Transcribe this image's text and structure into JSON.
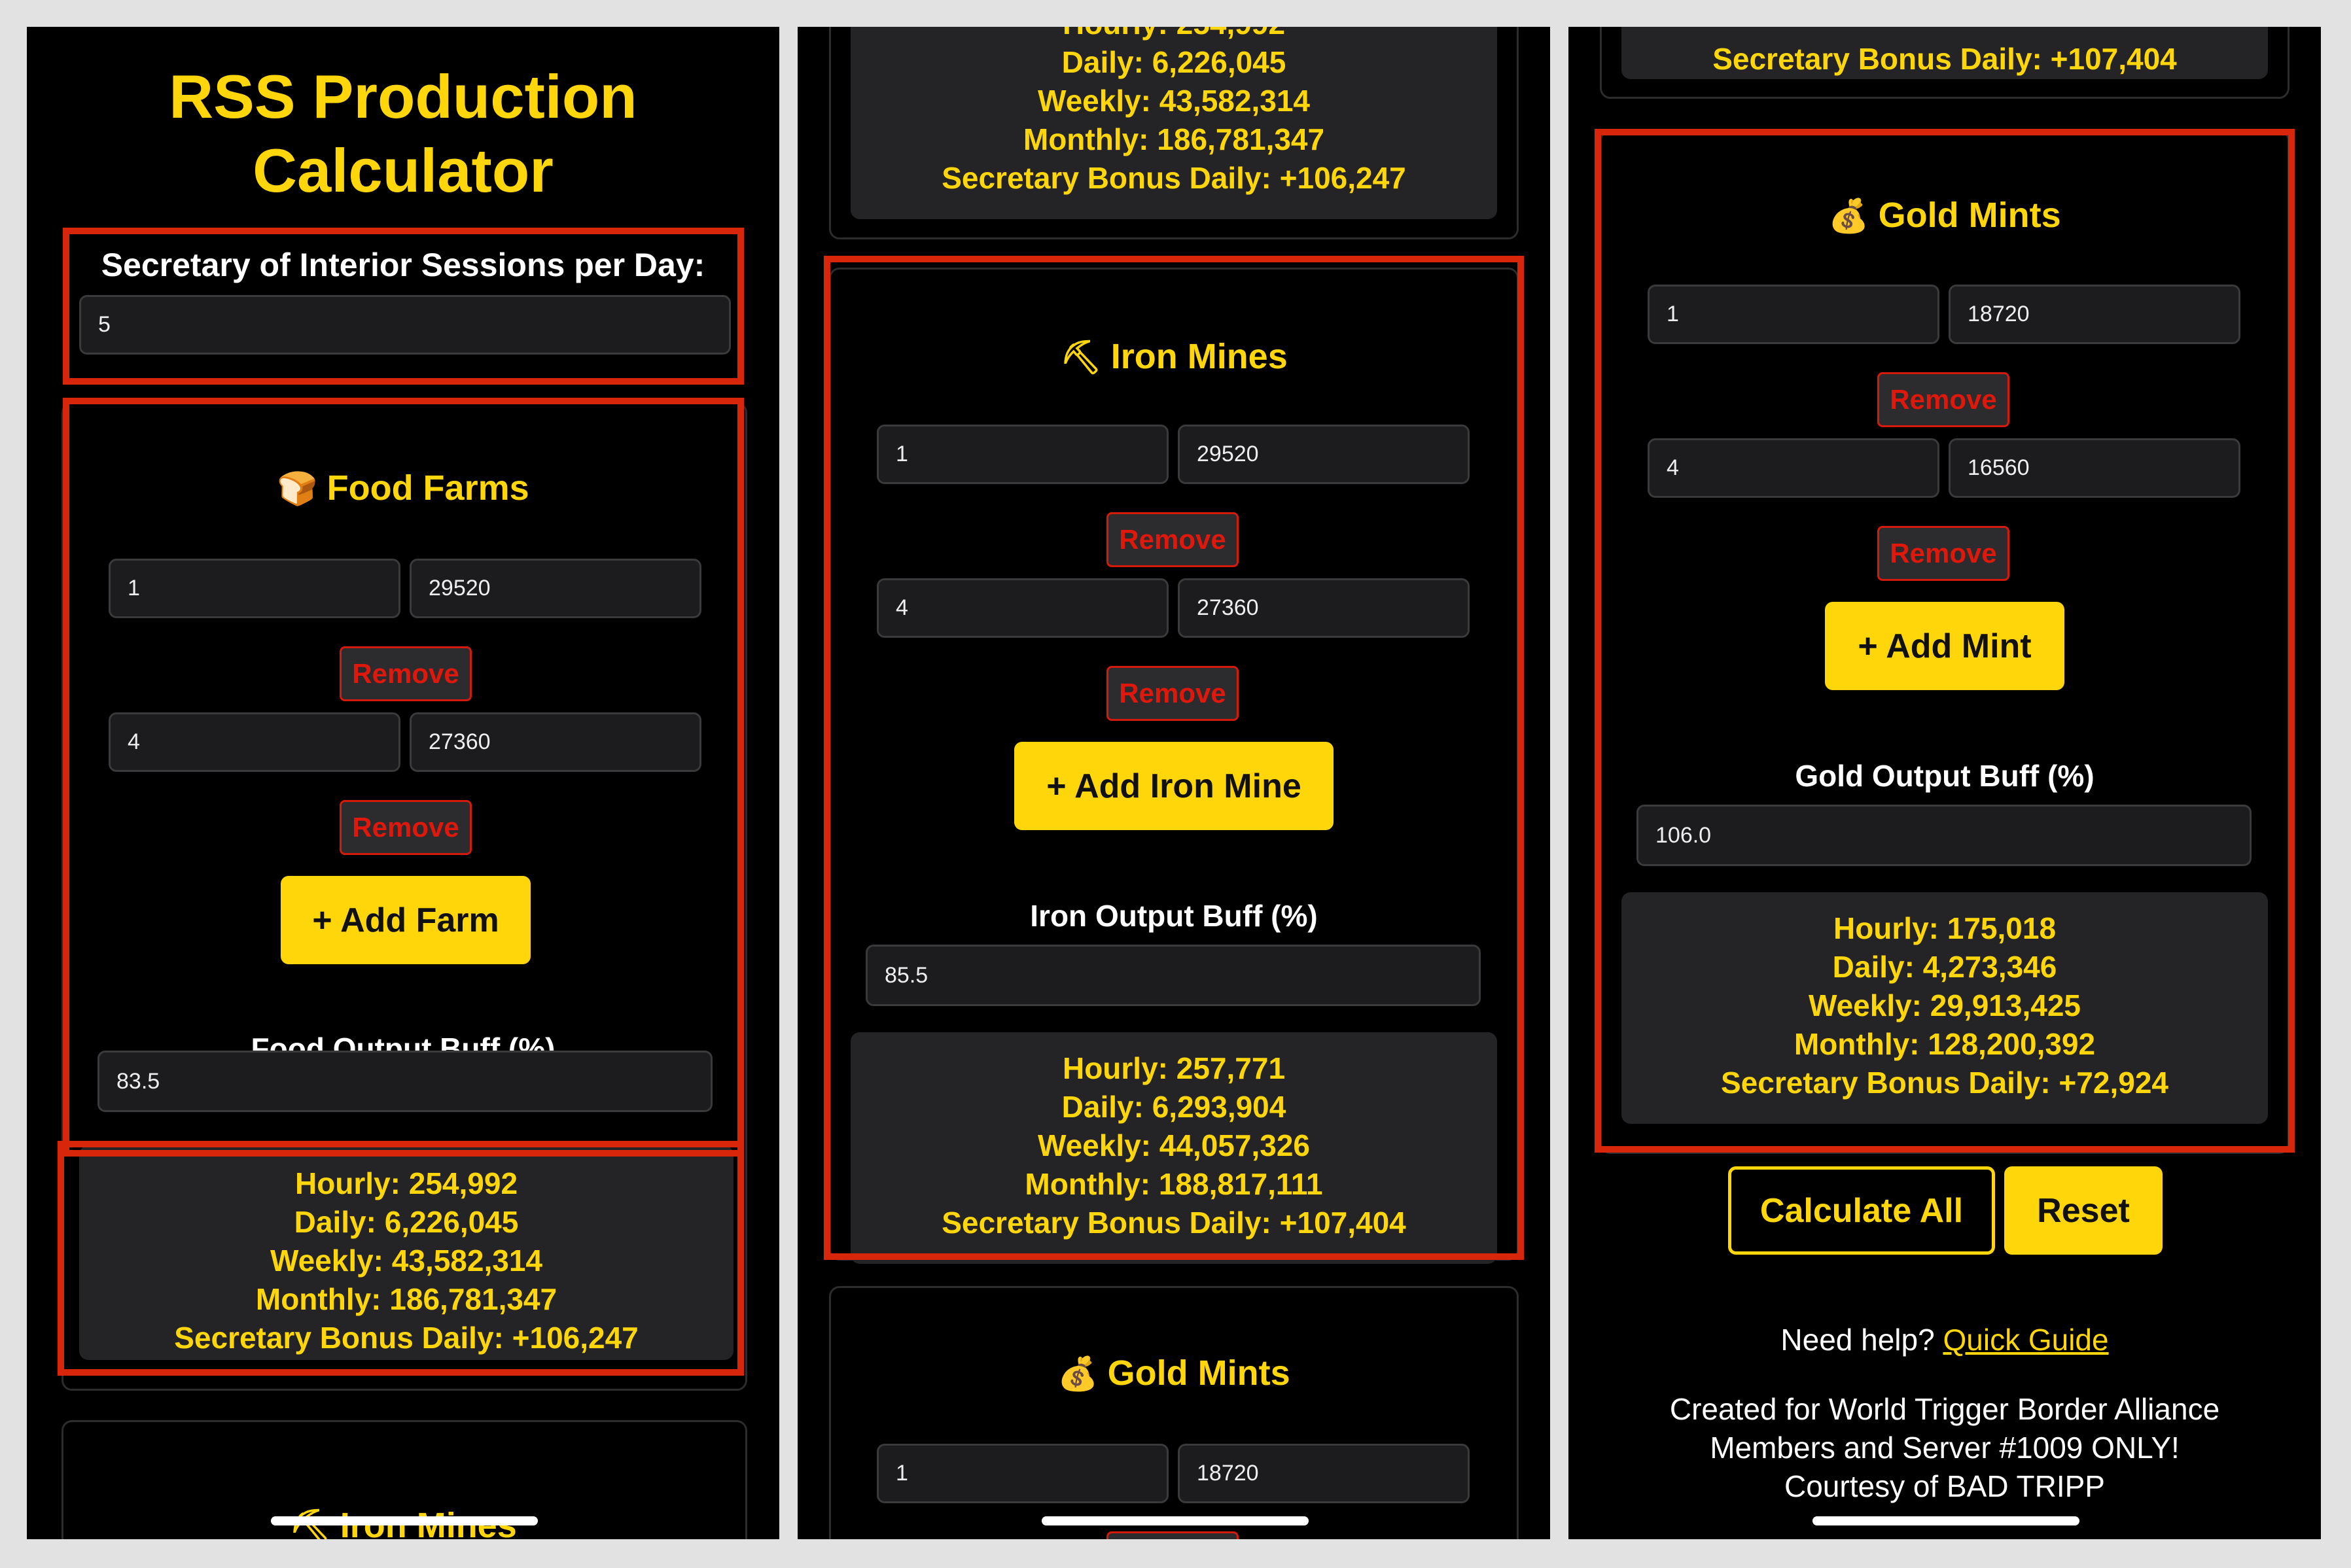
{
  "app": {
    "title_line1": "RSS Production",
    "title_line2": "Calculator",
    "sessions_label": "Secretary of Interior Sessions per Day:",
    "sessions_value": "5"
  },
  "food": {
    "title": "Food Farms",
    "icon": "bread-icon",
    "rows": [
      {
        "level": "1",
        "amount": "29520"
      },
      {
        "level": "4",
        "amount": "27360"
      }
    ],
    "remove_label": "Remove",
    "add_label": "+ Add Farm",
    "buff_label": "Food Output Buff (%)",
    "buff_value": "83.5",
    "results": {
      "hourly": "Hourly: 254,992",
      "daily": "Daily: 6,226,045",
      "weekly": "Weekly: 43,582,314",
      "monthly": "Monthly: 186,781,347",
      "bonus": "Secretary Bonus Daily: +106,247"
    }
  },
  "iron": {
    "title": "Iron Mines",
    "icon": "pickaxe-icon",
    "rows": [
      {
        "level": "1",
        "amount": "29520"
      },
      {
        "level": "4",
        "amount": "27360"
      }
    ],
    "remove_label": "Remove",
    "add_label": "+ Add Iron Mine",
    "buff_label": "Iron Output Buff (%)",
    "buff_value": "85.5",
    "results": {
      "hourly": "Hourly: 257,771",
      "daily": "Daily: 6,293,904",
      "weekly": "Weekly: 44,057,326",
      "monthly": "Monthly: 188,817,111",
      "bonus": "Secretary Bonus Daily: +107,404"
    }
  },
  "gold": {
    "title": "Gold Mints",
    "icon": "money-bag-icon",
    "rows": [
      {
        "level": "1",
        "amount": "18720"
      },
      {
        "level": "4",
        "amount": "16560"
      }
    ],
    "remove_label": "Remove",
    "add_label": "+ Add Mint",
    "buff_label": "Gold Output Buff (%)",
    "buff_value": "106.0",
    "results": {
      "hourly": "Hourly: 175,018",
      "daily": "Daily: 4,273,346",
      "weekly": "Weekly: 29,913,425",
      "monthly": "Monthly: 128,200,392",
      "bonus": "Secretary Bonus Daily: +72,924"
    }
  },
  "actions": {
    "calculate_label": "Calculate All",
    "reset_label": "Reset"
  },
  "footer": {
    "help_text": "Need help?",
    "help_link": "Quick Guide",
    "credit_line1": "Created for World Trigger Border Alliance",
    "credit_line2": "Members and Server #1009 ONLY!",
    "credit_line3": "Courtesy of BAD TRIPP"
  },
  "colors": {
    "accent": "#FFD60A",
    "background": "#000000",
    "highlight": "#d8260b",
    "remove_text": "#e0180c"
  }
}
